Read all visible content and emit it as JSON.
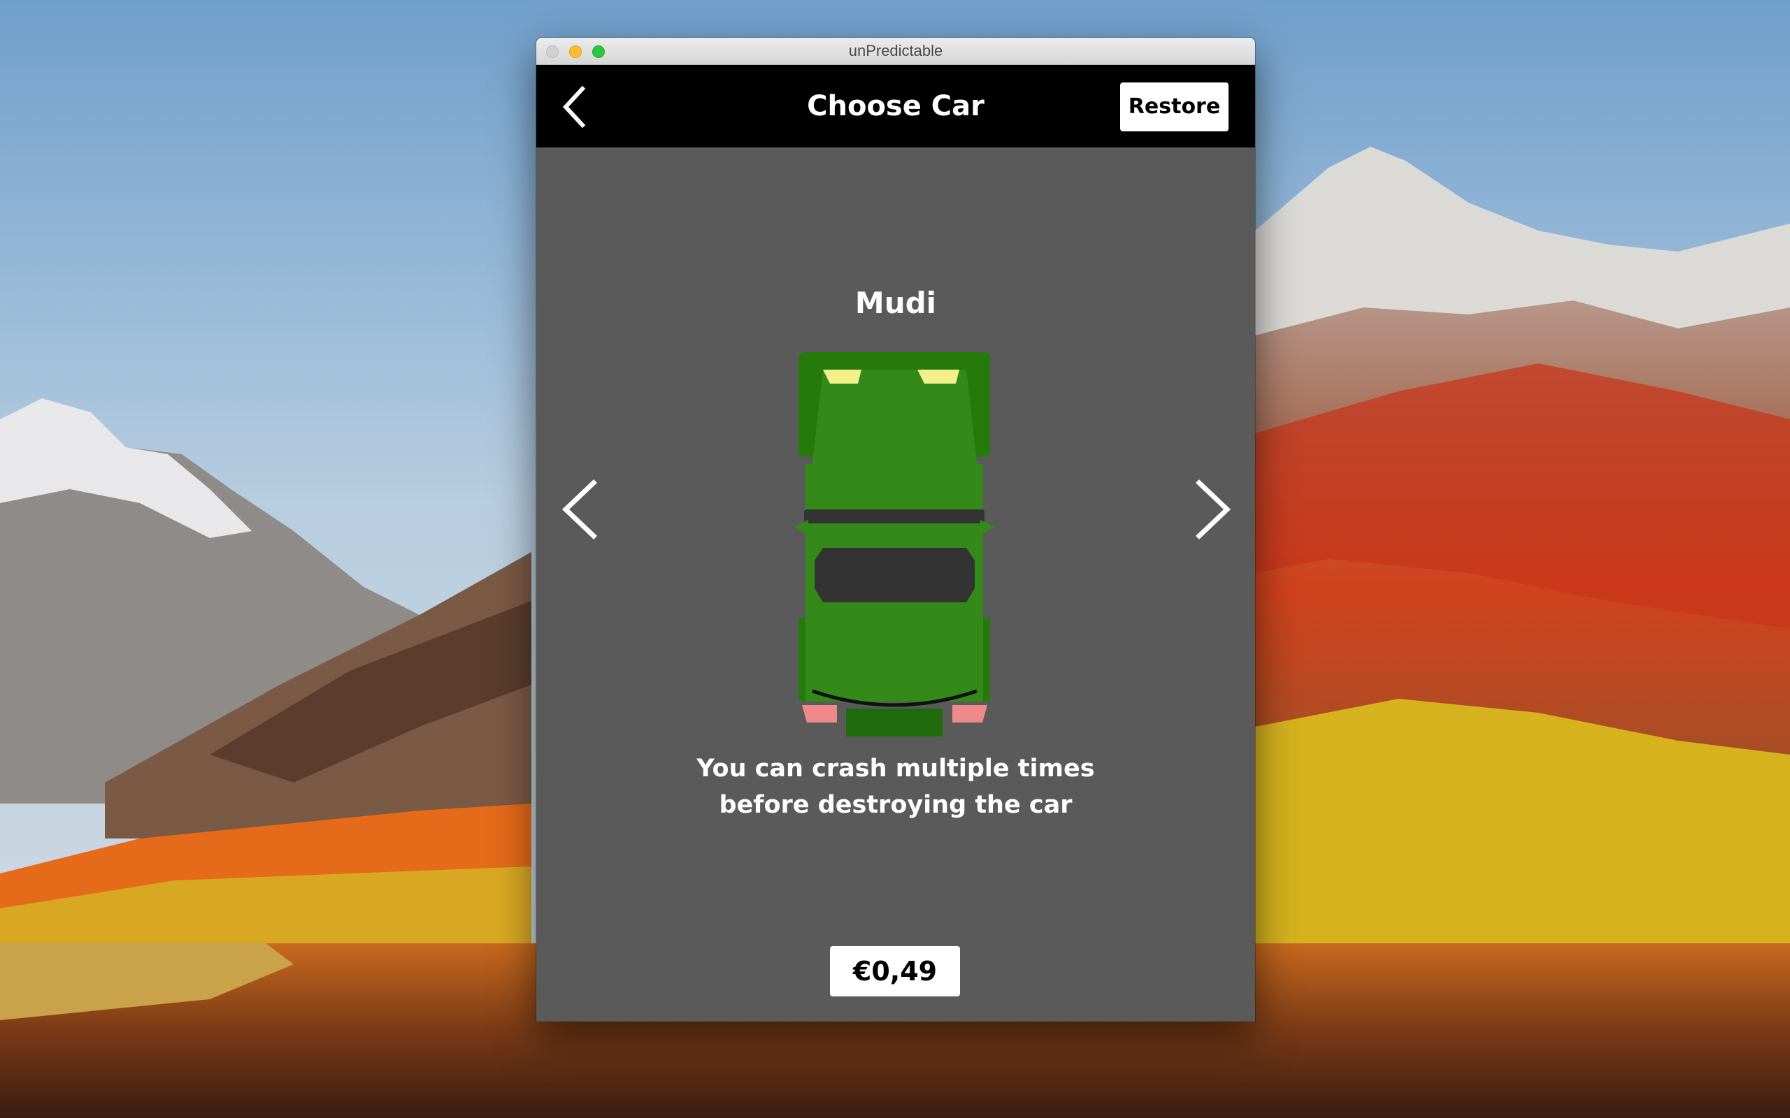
{
  "window": {
    "title": "unPredictable"
  },
  "navbar": {
    "back_icon": "chevron-left-icon",
    "title": "Choose Car",
    "restore_label": "Restore"
  },
  "car": {
    "name": "Mudi",
    "description_line1": "You can crash multiple times",
    "description_line2": "before destroying the car",
    "price_label": "€0,49",
    "body_color": "#2e7d12"
  },
  "carousel": {
    "prev_icon": "chevron-left-icon",
    "next_icon": "chevron-right-icon"
  },
  "colors": {
    "navbar_bg": "#000000",
    "content_bg": "#5a5a5a",
    "button_bg": "#ffffff"
  }
}
